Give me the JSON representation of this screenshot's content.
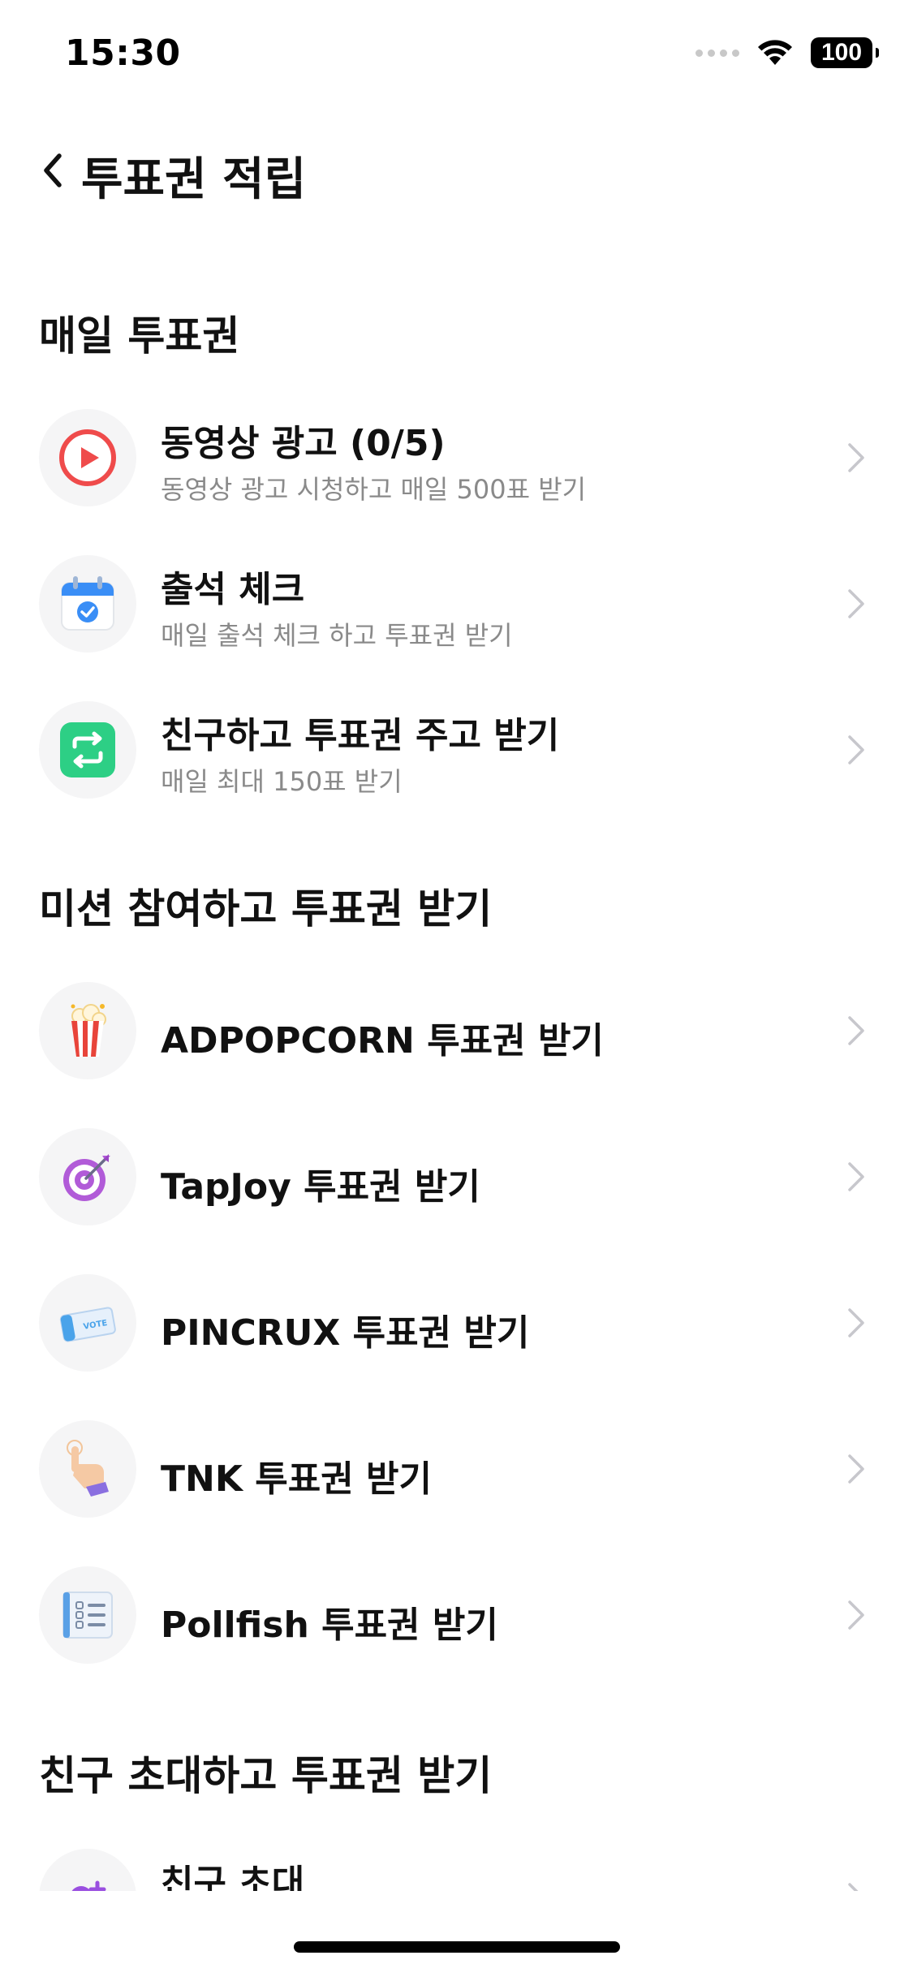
{
  "status_bar": {
    "time": "15:30",
    "battery": "100"
  },
  "nav": {
    "title": "투표권 적립"
  },
  "sections": {
    "daily": {
      "title": "매일 투표권",
      "items": [
        {
          "title": "동영상 광고 (0/5)",
          "subtitle": "동영상 광고 시청하고 매일 500표 받기",
          "icon": "play-video-icon"
        },
        {
          "title": "출석 체크",
          "subtitle": "매일 출석 체크 하고 투표권 받기",
          "icon": "calendar-check-icon"
        },
        {
          "title": "친구하고 투표권 주고 받기",
          "subtitle": "매일 최대 150표 받기",
          "icon": "exchange-arrows-icon"
        }
      ]
    },
    "mission": {
      "title": "미션 참여하고 투표권 받기",
      "items": [
        {
          "title": "ADPOPCORN 투표권 받기",
          "icon": "popcorn-icon"
        },
        {
          "title": "TapJoy 투표권 받기",
          "icon": "target-dart-icon"
        },
        {
          "title": "PINCRUX 투표권 받기",
          "icon": "vote-ticket-icon"
        },
        {
          "title": "TNK 투표권 받기",
          "icon": "tap-hand-icon"
        },
        {
          "title": "Pollfish 투표권 받기",
          "icon": "survey-list-icon"
        }
      ]
    },
    "invite": {
      "title": "친구 초대하고 투표권 받기",
      "items": [
        {
          "title": "친구 초대",
          "icon": "add-friend-icon"
        }
      ]
    }
  },
  "colors": {
    "text_primary": "#111111",
    "text_secondary": "#8a8a8a",
    "icon_bg": "#f5f5f6",
    "chevron": "#c7c7cc"
  }
}
